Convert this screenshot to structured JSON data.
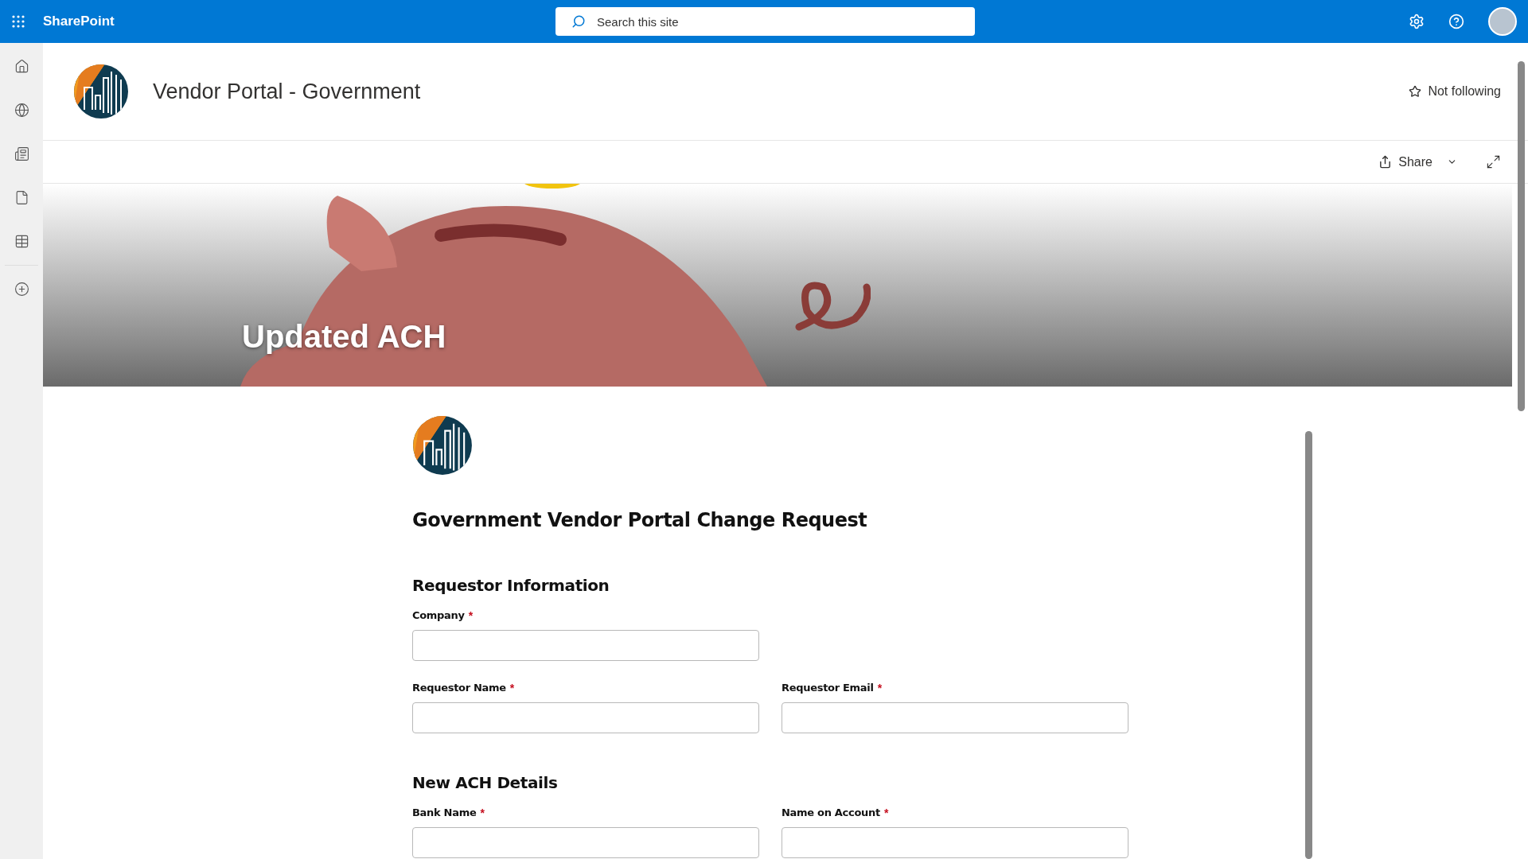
{
  "top_bar": {
    "app_name": "SharePoint",
    "search": {
      "placeholder": "Search this site"
    }
  },
  "site_header": {
    "title": "Vendor Portal - Government",
    "follow": "Not following"
  },
  "command_bar": {
    "share": "Share"
  },
  "banner": {
    "title": "Updated ACH"
  },
  "form": {
    "title": "Government Vendor Portal Change Request",
    "sections": [
      {
        "heading": "Requestor Information",
        "rows": [
          [
            {
              "label": "Company",
              "required_mark": "*"
            }
          ],
          [
            {
              "label": "Requestor Name",
              "required_mark": "*"
            },
            {
              "label": "Requestor Email",
              "required_mark": "*"
            }
          ]
        ]
      },
      {
        "heading": "New ACH Details",
        "rows": [
          [
            {
              "label": "Bank Name",
              "required_mark": "*"
            },
            {
              "label": "Name on Account",
              "required_mark": "*"
            }
          ]
        ]
      }
    ]
  }
}
